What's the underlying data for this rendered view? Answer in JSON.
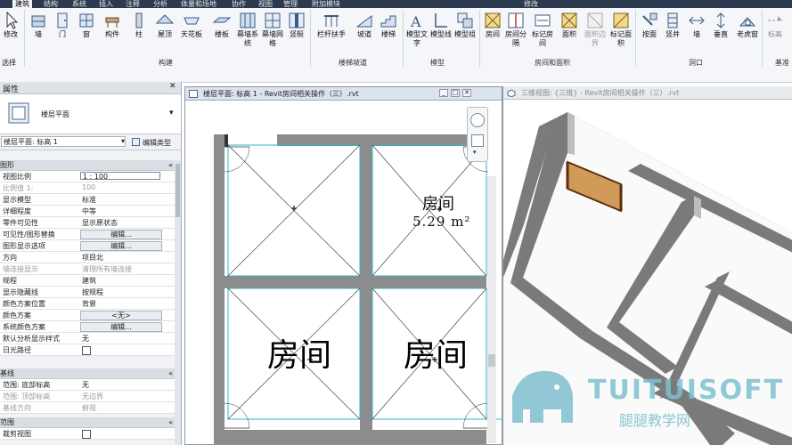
{
  "tabs": [
    "建筑",
    "结构",
    "系统",
    "插入",
    "注释",
    "分析",
    "体量和场地",
    "协作",
    "视图",
    "管理",
    "附加模块",
    "修改"
  ],
  "ribbon": {
    "modify": {
      "label": "修改",
      "dropdown": "选择"
    },
    "build": {
      "group_label": "构建",
      "buttons": [
        "墙",
        "门",
        "窗",
        "构件",
        "柱",
        "屋顶",
        "天花板",
        "楼板",
        "幕墙系统",
        "幕墙网格",
        "竖梃"
      ]
    },
    "circulation": {
      "group_label": "楼梯坡道",
      "buttons": [
        "栏杆扶手",
        "坡道",
        "楼梯"
      ]
    },
    "model": {
      "group_label": "模型",
      "buttons": [
        "模型文字",
        "模型线",
        "模型组"
      ]
    },
    "room": {
      "group_label": "房间和面积",
      "buttons": [
        "房间",
        "房间分隔",
        "标记房间",
        "面积",
        "面积边界",
        "标记面积"
      ]
    },
    "opening": {
      "group_label": "洞口",
      "buttons": [
        "按面",
        "竖井",
        "墙",
        "垂直",
        "老虎窗"
      ]
    },
    "datum": {
      "buttons": [
        "标高"
      ],
      "group_label": "基准"
    }
  },
  "properties": {
    "title": "属性",
    "type_name": "楼层平面",
    "selector": "楼层平面: 标高 1",
    "edit_type": "编辑类型",
    "categories": [
      "图形",
      "基线",
      "范围"
    ],
    "rows": [
      {
        "k": "视图比例",
        "v": "1 : 100"
      },
      {
        "k": "比例值 1:",
        "v": "100"
      },
      {
        "k": "显示模型",
        "v": "标准"
      },
      {
        "k": "详细程度",
        "v": "中等"
      },
      {
        "k": "零件可见性",
        "v": "显示原状态"
      },
      {
        "k": "可见性/图形替换",
        "v": "编辑..."
      },
      {
        "k": "图形显示选项",
        "v": "编辑..."
      },
      {
        "k": "方向",
        "v": "项目北"
      },
      {
        "k": "墙连接显示",
        "v": "清理所有墙连接"
      },
      {
        "k": "规程",
        "v": "建筑"
      },
      {
        "k": "显示隐藏线",
        "v": "按规程"
      },
      {
        "k": "颜色方案位置",
        "v": "背景"
      },
      {
        "k": "颜色方案",
        "v": "<无>"
      },
      {
        "k": "系统颜色方案",
        "v": "编辑..."
      },
      {
        "k": "默认分析显示样式",
        "v": "无"
      },
      {
        "k": "日光路径",
        "v": ""
      },
      {
        "k": "范围: 底部标高",
        "v": "无"
      },
      {
        "k": "范围: 顶部标高",
        "v": "无边界"
      },
      {
        "k": "基线方向",
        "v": "俯视"
      },
      {
        "k": "裁剪视图",
        "v": ""
      }
    ]
  },
  "view1": {
    "title": "楼层平面: 标高 1 - Revit房间相关操作（三）.rvt",
    "room_tag_name": "房间",
    "room_tag_area": "5.29 m²",
    "big_labels": [
      "房间",
      "房间"
    ]
  },
  "view2": {
    "title": "三维视图: {三维} - Revit房间相关操作（三）.rvt"
  },
  "watermark": {
    "brand": "TUITUISOFT",
    "sub": "腿腿教学网"
  }
}
